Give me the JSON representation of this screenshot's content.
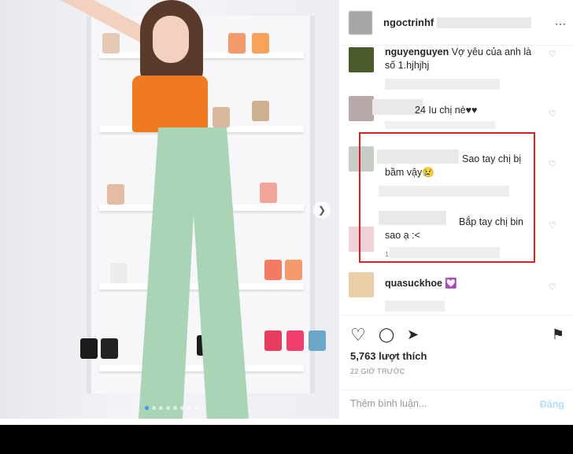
{
  "post": {
    "username": "ngoctrinhf",
    "likes_label": "5,763 lượt thích",
    "time_label": "22 GIỜ TRƯỚC",
    "carousel": {
      "total": 8,
      "active": 1
    }
  },
  "comments": [
    {
      "name": "nguyenguyen",
      "text": "Vợ yêu của anh là số 1.hjhjhj"
    },
    {
      "name": "",
      "text": "24 Iu chị nè♥♥"
    },
    {
      "name": "",
      "text": "Sao tay chị bị bầm vậy😢"
    },
    {
      "name": "",
      "text": "Bắp tay chị bin sao ạ :<"
    },
    {
      "name": "quasuckhoe",
      "text": "💟"
    }
  ],
  "comment_meta": {
    "partial": "1"
  },
  "input": {
    "placeholder": "Thêm bình luận...",
    "post_label": "Đăng"
  },
  "icons": {
    "more": "⋯",
    "like": "♡",
    "comment": "◯",
    "share": "➤",
    "save": "⚑",
    "next": "❯"
  },
  "colors": {
    "accent": "#3897f0",
    "highlight": "#d92020",
    "post_disabled": "#b2dffc"
  }
}
